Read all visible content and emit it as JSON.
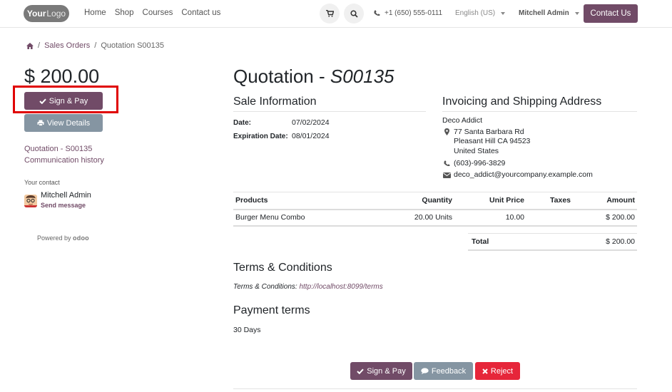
{
  "header": {
    "logo": {
      "part1": "Your",
      "part2": "Logo"
    },
    "nav": [
      "Home",
      "Shop",
      "Courses",
      "Contact us"
    ],
    "phone": "+1 (650) 555-0111",
    "language": "English (US)",
    "user": "Mitchell Admin",
    "contact_button": "Contact Us"
  },
  "breadcrumb": {
    "items": [
      "Sales Orders",
      "Quotation S00135"
    ]
  },
  "sidebar": {
    "amount": "$ 200.00",
    "sign_pay": "Sign & Pay",
    "view_details": "View Details",
    "links": [
      "Quotation - S00135",
      "Communication history"
    ],
    "contact_label": "Your contact",
    "contact_name": "Mitchell Admin",
    "send_message": "Send message",
    "powered_by": "Powered by",
    "powered_brand": "odoo"
  },
  "main": {
    "title_prefix": "Quotation - ",
    "title_number": "S00135",
    "sale_info": {
      "heading": "Sale Information",
      "date_label": "Date:",
      "date_value": "07/02/2024",
      "exp_label": "Expiration Date:",
      "exp_value": "08/01/2024"
    },
    "address": {
      "heading": "Invoicing and Shipping Address",
      "name": "Deco Addict",
      "street": "77 Santa Barbara Rd",
      "city": "Pleasant Hill CA 94523",
      "country": "United States",
      "phone": "(603)-996-3829",
      "email": "deco_addict@yourcompany.example.com"
    },
    "table": {
      "headers": [
        "Products",
        "Quantity",
        "Unit Price",
        "Taxes",
        "Amount"
      ],
      "rows": [
        {
          "product": "Burger Menu Combo",
          "quantity": "20.00 Units",
          "unit_price": "10.00",
          "taxes": "",
          "amount": "$ 200.00"
        }
      ],
      "total_label": "Total",
      "total_value": "$ 200.00"
    },
    "terms": {
      "heading": "Terms & Conditions",
      "label": "Terms & Conditions: ",
      "link": "http://localhost:8099/terms"
    },
    "payment": {
      "heading": "Payment terms",
      "value": "30 Days"
    },
    "actions": {
      "sign_pay": "Sign & Pay",
      "feedback": "Feedback",
      "reject": "Reject"
    }
  },
  "colors": {
    "primary": "#714b67",
    "secondary": "#8595a2",
    "danger": "#e6263a",
    "highlight": "#e00000"
  }
}
